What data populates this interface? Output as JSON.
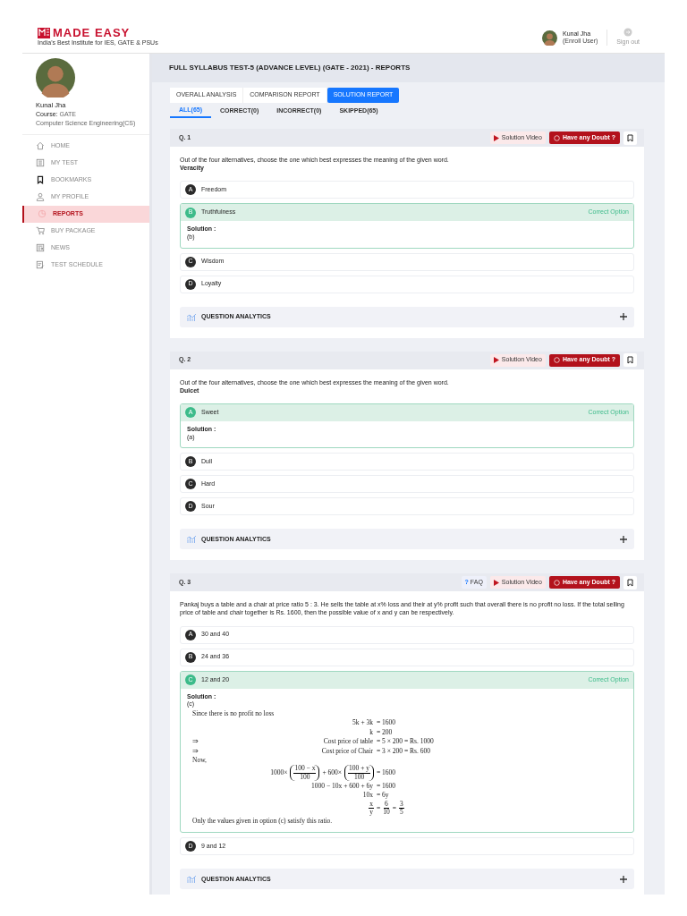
{
  "header": {
    "brand": "MADE EASY",
    "tagline": "India's Best Institute for IES, GATE & PSUs",
    "user_name": "Kunal Jha",
    "user_role": "(Enroll User)",
    "sign_out": "Sign out"
  },
  "profile": {
    "name": "Kunal Jha",
    "course_label": "Course:",
    "course": "GATE",
    "branch": "Computer Science Engineering(CS)"
  },
  "sidebar": {
    "items": [
      {
        "label": "HOME",
        "selected": false
      },
      {
        "label": "MY TEST",
        "selected": false
      },
      {
        "label": "BOOKMARKS",
        "selected": false
      },
      {
        "label": "MY PROFILE",
        "selected": false
      },
      {
        "label": "REPORTS",
        "selected": true
      },
      {
        "label": "BUY PACKAGE",
        "selected": false
      },
      {
        "label": "NEWS",
        "selected": false
      },
      {
        "label": "TEST SCHEDULE",
        "selected": false
      }
    ]
  },
  "page_title": "FULL SYLLABUS TEST-5 (ADVANCE LEVEL) (GATE - 2021) - REPORTS",
  "tabs": [
    {
      "label": "OVERALL ANALYSIS",
      "selected": false
    },
    {
      "label": "COMPARISON REPORT",
      "selected": false
    },
    {
      "label": "SOLUTION REPORT",
      "selected": true
    }
  ],
  "filters": [
    {
      "label": "ALL(65)",
      "selected": true
    },
    {
      "label": "CORRECT(0)",
      "selected": false
    },
    {
      "label": "INCORRECT(0)",
      "selected": false
    },
    {
      "label": "SKIPPED(65)",
      "selected": false
    }
  ],
  "questions": [
    {
      "number": "Q. 1",
      "solution_video": "Solution Video",
      "doubt": "Have any Doubt ?",
      "text": "Out of the four alternatives, choose the one which best expresses the meaning of the given word.",
      "word": "Veracity",
      "analytics": "QUESTION ANALYTICS",
      "options": [
        {
          "letter": "A",
          "text": "Freedom",
          "correct": false
        },
        {
          "letter": "B",
          "text": "Truthfulness",
          "correct": true,
          "correct_label": "Correct Option",
          "solution_label": "Solution :",
          "solution": "(b)"
        },
        {
          "letter": "C",
          "text": "Wisdom",
          "correct": false
        },
        {
          "letter": "D",
          "text": "Loyalty",
          "correct": false
        }
      ]
    },
    {
      "number": "Q. 2",
      "solution_video": "Solution Video",
      "doubt": "Have any Doubt ?",
      "text": "Out of the four alternatives, choose the one which best expresses the meaning of the given word.",
      "word": "Dulcet",
      "analytics": "QUESTION ANALYTICS",
      "options": [
        {
          "letter": "A",
          "text": "Sweet",
          "correct": true,
          "correct_label": "Correct Option",
          "solution_label": "Solution :",
          "solution": "(a)"
        },
        {
          "letter": "B",
          "text": "Dull",
          "correct": false
        },
        {
          "letter": "C",
          "text": "Hard",
          "correct": false
        },
        {
          "letter": "D",
          "text": "Sour",
          "correct": false
        }
      ]
    },
    {
      "number": "Q. 3",
      "faq": "FAQ",
      "faq_mark": "?",
      "solution_video": "Solution Video",
      "doubt": "Have any Doubt ?",
      "text": "Pankaj buys a table and a chair at price ratio 5 : 3. He sells the table at x% loss and their at y% profit such that overall there is no profit no loss. If the total selling price of table and chair together is Rs. 1600, then the possible value of x and y can be respectively.",
      "analytics": "QUESTION ANALYTICS",
      "options": [
        {
          "letter": "A",
          "text": "30 and 40",
          "correct": false
        },
        {
          "letter": "B",
          "text": "24 and 36",
          "correct": false
        },
        {
          "letter": "C",
          "text": "12 and 20",
          "correct": true,
          "correct_label": "Correct Option",
          "solution_label": "Solution :",
          "solution": "(c)",
          "working": [
            {
              "kind": "text",
              "text": "Since there is no profit no loss"
            },
            {
              "kind": "math",
              "lhs": [
                {
                  "text": "5k + 3k"
                }
              ],
              "rhs": [
                {
                  "text": "= 1600"
                }
              ]
            },
            {
              "kind": "math",
              "lhs": [
                {
                  "text": "k"
                }
              ],
              "rhs": [
                {
                  "text": "= 200"
                }
              ]
            },
            {
              "kind": "math",
              "prefix": "⇒",
              "lhs": [
                {
                  "text": "Cost price of table"
                }
              ],
              "rhs": [
                {
                  "text": "= 5 × 200 = Rs. 1000"
                }
              ]
            },
            {
              "kind": "math",
              "prefix": "⇒",
              "lhs": [
                {
                  "text": "Cost price of Chair"
                }
              ],
              "rhs": [
                {
                  "text": "= 3 × 200 = Rs. 600"
                }
              ]
            },
            {
              "kind": "text",
              "text": "Now,"
            },
            {
              "kind": "math",
              "lhs": [
                {
                  "text": "1000×"
                },
                {
                  "num": "100 − x",
                  "den": "100",
                  "paren": true
                },
                {
                  "text": "+ 600×"
                },
                {
                  "num": "100 + y",
                  "den": "100",
                  "paren": true
                }
              ],
              "rhs": [
                {
                  "text": "= 1600"
                }
              ]
            },
            {
              "kind": "math",
              "lhs": [
                {
                  "text": "1000 − 10x + 600 + 6y"
                }
              ],
              "rhs": [
                {
                  "text": "= 1600"
                }
              ]
            },
            {
              "kind": "math",
              "lhs": [
                {
                  "text": "10x"
                }
              ],
              "rhs": [
                {
                  "text": "= 6y"
                }
              ]
            },
            {
              "kind": "math",
              "lhs": [
                {
                  "num": "x",
                  "den": "y"
                }
              ],
              "rhs": [
                {
                  "text": "="
                },
                {
                  "num": "6",
                  "den": "10"
                },
                {
                  "text": "="
                },
                {
                  "num": "3",
                  "den": "5"
                }
              ]
            },
            {
              "kind": "text",
              "text": "Only the values given in option (c) satisfy this ratio."
            }
          ]
        },
        {
          "letter": "D",
          "text": "9 and 12",
          "correct": false
        }
      ]
    }
  ]
}
